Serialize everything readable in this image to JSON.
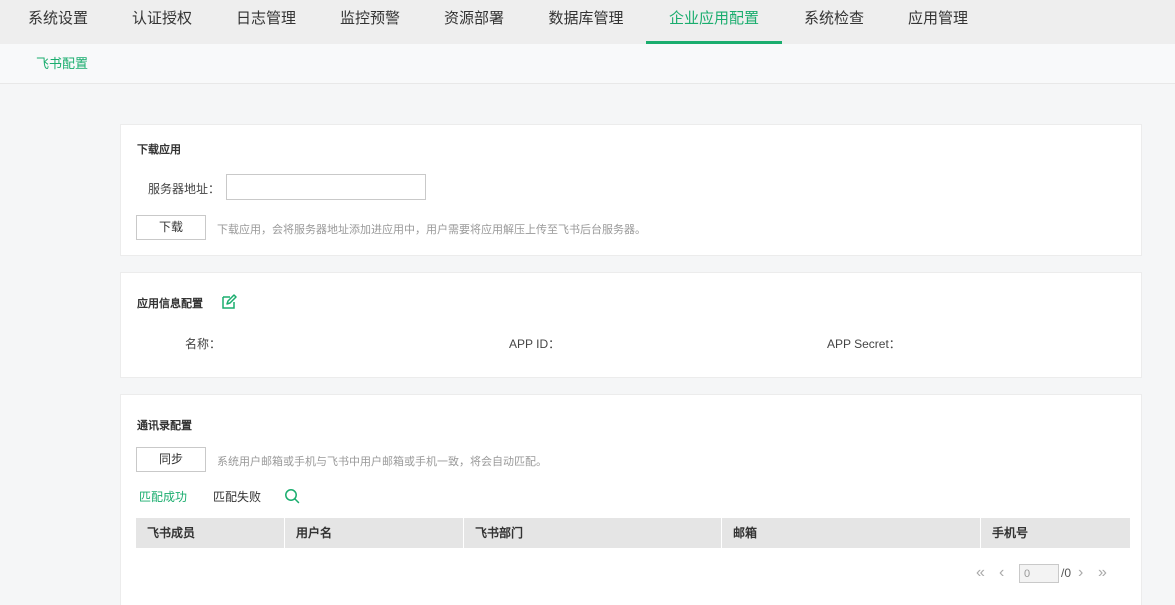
{
  "top_nav": {
    "tabs": [
      {
        "label": "系统设置"
      },
      {
        "label": "认证授权"
      },
      {
        "label": "日志管理"
      },
      {
        "label": "监控预警"
      },
      {
        "label": "资源部署"
      },
      {
        "label": "数据库管理"
      },
      {
        "label": "企业应用配置",
        "active": true
      },
      {
        "label": "系统检查"
      },
      {
        "label": "应用管理"
      }
    ]
  },
  "sub_nav": {
    "label": "飞书配置"
  },
  "download_card": {
    "title": "下载应用",
    "server_label": "服务器地址：",
    "server_value": "",
    "download_button": "下载",
    "hint": "下载应用，会将服务器地址添加进应用中，用户需要将应用解压上传至飞书后台服务器。"
  },
  "app_info_card": {
    "title": "应用信息配置",
    "name_label": "名称：",
    "app_id_label": "APP ID：",
    "app_secret_label": "APP Secret："
  },
  "contacts_card": {
    "title": "通讯录配置",
    "sync_button": "同步",
    "hint": "系统用户邮箱或手机与飞书中用户邮箱或手机一致，将会自动匹配。",
    "filters": {
      "matched": "匹配成功",
      "unmatched": "匹配失败"
    },
    "columns": [
      "飞书成员",
      "用户名",
      "飞书部门",
      "邮箱",
      "手机号"
    ],
    "pager": {
      "page": "0",
      "total": "/0"
    }
  },
  "colors": {
    "accent": "#1aad6e"
  }
}
